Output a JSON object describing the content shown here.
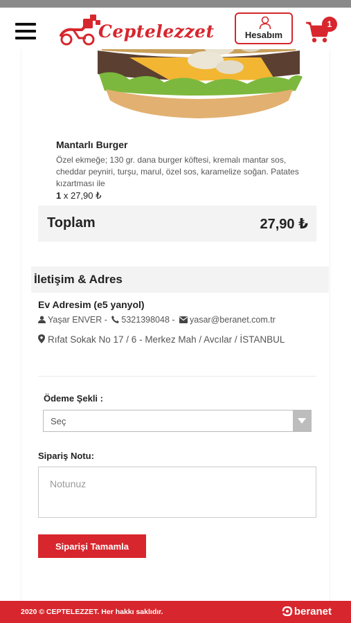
{
  "header": {
    "logo_text": "Ceptelezzet",
    "account_label": "Hesabım",
    "cart_count": "1"
  },
  "cart": {
    "item": {
      "name": "Mantarlı Burger",
      "description": "Özel ekmeğe; 130 gr. dana burger köftesi, kremalı mantar sos, cheddar peyniri, turşu, marul, özel sos, karamelize soğan. Patates kızartması ile",
      "qty": "1",
      "qty_sep": " x ",
      "price": "27,90 ₺"
    },
    "total_label": "Toplam",
    "total_value": "27,90 ₺"
  },
  "contact": {
    "section_title": "İletişim & Adres",
    "address_title": "Ev Adresim (e5 yanyol)",
    "name": "Yaşar ENVER -",
    "phone": "5321398048 -",
    "email": "yasar@beranet.com.tr",
    "address": "Rıfat Sokak No 17 / 6 - Merkez Mah / Avcılar / İSTANBUL"
  },
  "payment": {
    "label": "Ödeme Şekli :",
    "selected": "Seç"
  },
  "note": {
    "label": "Sipariş Notu:",
    "placeholder": "Notunuz"
  },
  "submit_label": "Siparişi Tamamla",
  "footer": {
    "copyright": "2020 © CEPTELEZZET. Her hakkı saklıdır.",
    "brand": "beranet"
  },
  "colors": {
    "accent": "#d7262d",
    "panel": "#f3f3f3"
  }
}
